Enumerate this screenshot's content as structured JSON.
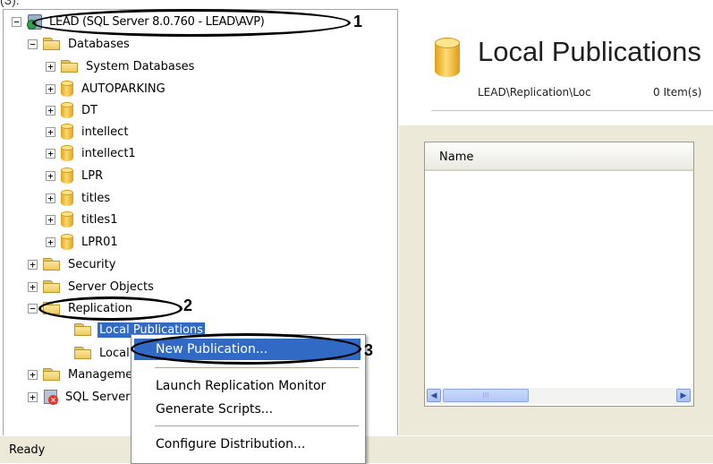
{
  "clipped_caption": "(З).",
  "tree": {
    "server": "LEAD (SQL Server 8.0.760 - LEAD\\AVP)",
    "databases": "Databases",
    "system_databases": "System Databases",
    "db_items": [
      "AUTOPARKING",
      "DT",
      "intellect",
      "intellect1",
      "LPR",
      "titles",
      "titles1",
      "LPR01"
    ],
    "security": "Security",
    "server_objects": "Server Objects",
    "replication": "Replication",
    "local_publications": "Local Publications",
    "local_subscriptions": "Local Subscriptions",
    "management": "Management",
    "sql_server_agent": "SQL Server Agent",
    "expand_plus": "+",
    "expand_minus": "−"
  },
  "right_pane": {
    "title": "Local Publications",
    "path": "LEAD\\Replication\\Loc",
    "item_count": "0 Item(s)",
    "column_header": "Name",
    "scroll_left": "◀",
    "scroll_right": "▶",
    "scroll_thumb": "III"
  },
  "context_menu": {
    "items": [
      "New Publication...",
      "Launch Replication Monitor",
      "Generate Scripts...",
      "Configure Distribution..."
    ]
  },
  "status_bar": {
    "text": "Ready"
  },
  "annotations": {
    "one": "1",
    "two": "2",
    "three": "3"
  }
}
